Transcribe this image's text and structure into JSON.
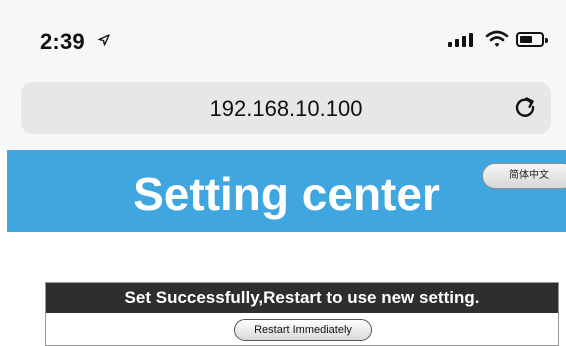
{
  "status_bar": {
    "time": "2:39",
    "location_arrow": "➶",
    "icons": [
      "location-arrow-icon",
      "cellular-signal-icon",
      "wifi-icon",
      "battery-icon"
    ]
  },
  "browser": {
    "url": "192.168.10.100",
    "reload_icon": "reload-icon"
  },
  "header": {
    "title": "Setting center",
    "language_button": "简体中文"
  },
  "notice": {
    "message": "Set Successfully,Restart to use new setting.",
    "restart_button": "Restart Immediately"
  },
  "colors": {
    "header_bg": "#40a6df",
    "notice_bar_bg": "#2e2e2e",
    "url_bar_bg": "#e7e7e9"
  }
}
